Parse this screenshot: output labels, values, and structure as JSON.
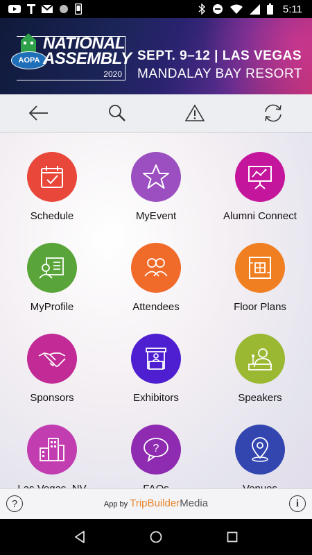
{
  "status_bar": {
    "time": "5:11",
    "left_icons": [
      "youtube-icon",
      "t-icon",
      "gmail-icon",
      "circle-icon",
      "phone-icon"
    ],
    "right_icons": [
      "bluetooth-icon",
      "dnd-icon",
      "wifi-icon",
      "signal-icon",
      "battery-icon"
    ]
  },
  "banner": {
    "logo_badge": "AOPA",
    "logo_line1": "NATIONAL",
    "logo_line2": "ASSEMBLY",
    "logo_year": "2020",
    "event_line1": "SEPT. 9–12  |  LAS VEGAS",
    "event_line2": "MANDALAY BAY RESORT"
  },
  "toolbar": {
    "buttons": [
      "back-icon",
      "search-icon",
      "alert-icon",
      "sync-icon"
    ]
  },
  "tiles": [
    {
      "label": "Schedule",
      "icon": "calendar-check-icon",
      "color": "#e8473a"
    },
    {
      "label": "MyEvent",
      "icon": "star-icon",
      "color": "#9b4fc0"
    },
    {
      "label": "Alumni Connect",
      "icon": "presentation-chart-icon",
      "color": "#c4169c"
    },
    {
      "label": "MyProfile",
      "icon": "profile-card-icon",
      "color": "#5aa53a"
    },
    {
      "label": "Attendees",
      "icon": "people-icon",
      "color": "#f06a2a"
    },
    {
      "label": "Floor Plans",
      "icon": "floor-plan-icon",
      "color": "#f07f22"
    },
    {
      "label": "Sponsors",
      "icon": "handshake-icon",
      "color": "#c22a95"
    },
    {
      "label": "Exhibitors",
      "icon": "booth-icon",
      "color": "#4d1fd1"
    },
    {
      "label": "Speakers",
      "icon": "speaker-podium-icon",
      "color": "#9ab832"
    },
    {
      "label": "Las Vegas, NV",
      "icon": "city-icon",
      "color": "#c23db0"
    },
    {
      "label": "FAQs",
      "icon": "question-bubble-icon",
      "color": "#8f2bb0"
    },
    {
      "label": "Venues",
      "icon": "map-pin-icon",
      "color": "#3346b0"
    }
  ],
  "footer": {
    "app_by": "App by",
    "brand_part1": "TripBuilder",
    "brand_part2": "Media",
    "help": "?",
    "info": "i"
  },
  "nav": [
    "back-triangle-icon",
    "home-circle-icon",
    "recents-square-icon"
  ]
}
